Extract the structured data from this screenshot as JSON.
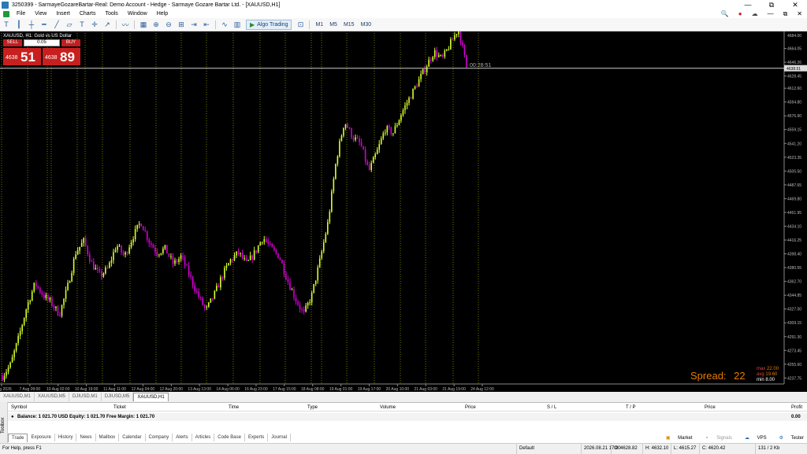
{
  "window": {
    "title": "3250399 - SarmayeGozareBartar-Real: Demo Account - Hedge - Sarmaye Gozare Bartar Ltd. - [XAUUSD,H1]",
    "minimize": "—",
    "maximize": "⧉",
    "close": "✕"
  },
  "menu": {
    "items": [
      "File",
      "View",
      "Insert",
      "Charts",
      "Tools",
      "Window",
      "Help"
    ]
  },
  "toolbar": {
    "algo_label": "Algo Trading",
    "timeframes": [
      "M1",
      "M5",
      "M15",
      "M30"
    ]
  },
  "chart": {
    "symbol_label": "XAUUSD, H1: Gold vs US Dollar",
    "sell_label": "SELL",
    "buy_label": "BUY",
    "lot": "0.05",
    "sell_price_prefix": "4638",
    "sell_price_big": "51",
    "buy_price_prefix": "4638",
    "buy_price_big": "89",
    "countdown": "00:28:51",
    "current_price": "4638.51",
    "spread_label": "Spread:",
    "spread_value": "22",
    "spread_stats": {
      "max_label": "max",
      "max": "22.00",
      "avg_label": "avg",
      "avg": "19.60",
      "min_label": "min",
      "min": "8.00"
    },
    "colors": {
      "bull": "#d7ff2a",
      "bear": "#d400d4",
      "background": "#000000",
      "grid": "#c8c800",
      "price_line": "#cccccc"
    }
  },
  "chart_data": {
    "type": "candlestick",
    "y_ticks": [
      "4664.05",
      "4646.26",
      "4628.45",
      "4612.60",
      "4594.80",
      "4576.90",
      "4559.15",
      "4541.20",
      "4523.35",
      "4505.50",
      "4487.65",
      "4469.80",
      "4451.95",
      "4434.10",
      "4416.25",
      "4398.40",
      "4380.55",
      "4362.70",
      "4344.85",
      "4327.00",
      "4309.15",
      "4291.30",
      "4273.45",
      "4255.60",
      "4237.75"
    ],
    "y_top_label": "4684.00",
    "x_ticks": [
      "6 Aug 2026",
      "7 Aug 09:00",
      "10 Aug 02:00",
      "10 Aug 19:00",
      "11 Aug 11:00",
      "12 Aug 04:00",
      "12 Aug 20:00",
      "13 Aug 13:00",
      "14 Aug 06:00",
      "16 Aug 23:00",
      "17 Aug 15:00",
      "18 Aug 08:00",
      "19 Aug 01:00",
      "19 Aug 17:00",
      "20 Aug 10:00",
      "21 Aug 03:00",
      "21 Aug 19:00",
      "24 Aug 12:00"
    ],
    "ylim": [
      4230,
      4684
    ],
    "path_closes": [
      4240,
      4255,
      4290,
      4330,
      4360,
      4345,
      4335,
      4320,
      4355,
      4400,
      4415,
      4385,
      4370,
      4380,
      4410,
      4395,
      4420,
      4440,
      4415,
      4400,
      4405,
      4385,
      4395,
      4370,
      4345,
      4325,
      4345,
      4370,
      4390,
      4400,
      4385,
      4400,
      4420,
      4405,
      4395,
      4365,
      4340,
      4320,
      4345,
      4390,
      4440,
      4520,
      4570,
      4550,
      4540,
      4505,
      4530,
      4560,
      4555,
      4580,
      4600,
      4620,
      4640,
      4660,
      4650,
      4670,
      4690,
      4640
    ]
  },
  "chart_tabs": [
    "XAUUSD,M1",
    "XAUUSD,M5",
    "DJIUSD,M1",
    "DJIUSD,M5",
    "XAUUSD,H1"
  ],
  "toolbox": {
    "side_label": "Toolbox",
    "headers": [
      "Symbol",
      "Ticket",
      "Time",
      "Type",
      "Volume",
      "Price",
      "S / L",
      "T / P",
      "Price",
      "Profit"
    ],
    "balance_line": "Balance: 1 021.70 USD  Equity: 1 021.70  Free Margin: 1 021.70",
    "profit": "0.00",
    "tabs": [
      "Trade",
      "Exposure",
      "History",
      "News",
      "Mailbox",
      "Calendar",
      "Company",
      "Alerts",
      "Articles",
      "Code Base",
      "Experts",
      "Journal"
    ],
    "right": [
      "Market",
      "Signals",
      "VPS",
      "Tester"
    ]
  },
  "status": {
    "help": "For Help, press F1",
    "profile": "Default",
    "time": "2026.08.21 17:00",
    "open": "O: 4628.82",
    "high": "H: 4632.10",
    "low": "L: 4615.27",
    "close": "C: 4620.42",
    "traffic": "131 / 2 Kb"
  }
}
